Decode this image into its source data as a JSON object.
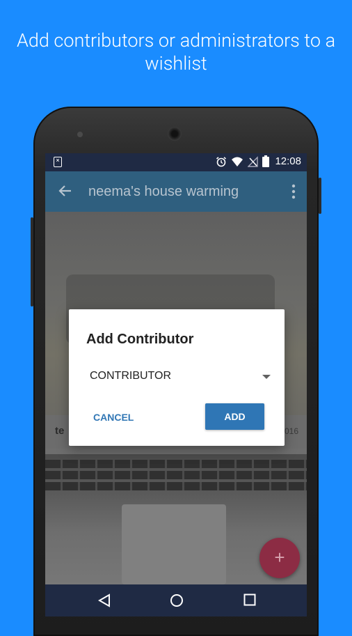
{
  "headline": "Add contributors or administrators to a wishlist",
  "status_bar": {
    "time": "12:08",
    "sim_icon": "sim-card-icon",
    "icons": [
      "alarm-icon",
      "wifi-icon",
      "no-signal-icon",
      "battery-icon"
    ]
  },
  "app_bar": {
    "title": "neema's house warming",
    "back_icon": "arrow-back-icon",
    "menu_icon": "more-vert-icon"
  },
  "card": {
    "name_partial": "te",
    "date_partial": "016"
  },
  "dialog": {
    "title": "Add Contributor",
    "selected_role": "CONTRIBUTOR",
    "cancel_label": "CANCEL",
    "add_label": "ADD"
  },
  "fab": {
    "label": "+",
    "icon": "add-icon"
  },
  "nav_bar": {
    "icons": [
      "back-triangle-icon",
      "home-circle-icon",
      "recents-square-icon"
    ]
  },
  "colors": {
    "background": "#1a8cff",
    "app_bar": "#2f5f7f",
    "status_bar": "#1f2a44",
    "accent": "#2f76b5",
    "fab": "#8c2c44"
  }
}
